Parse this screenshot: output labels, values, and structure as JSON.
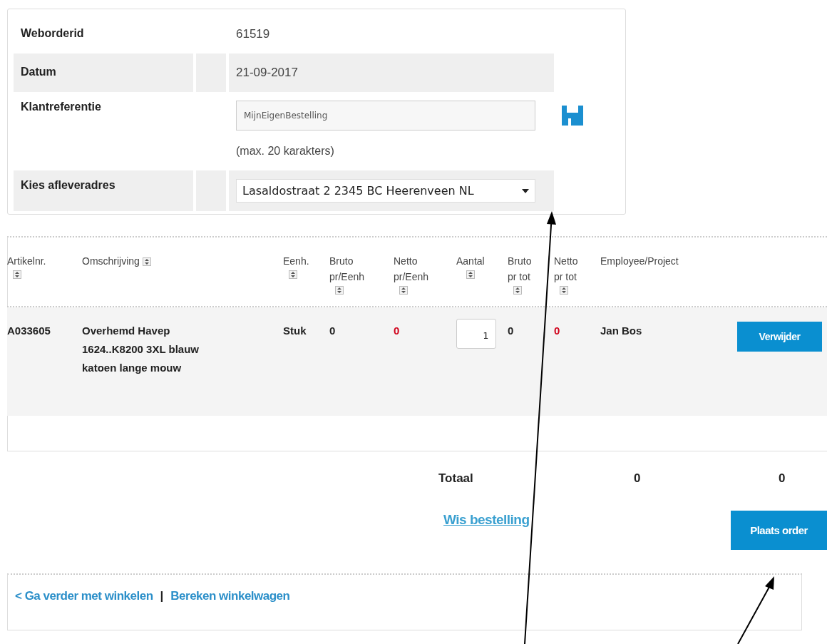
{
  "order_info": {
    "rows": [
      {
        "kind": "text",
        "label": "Weborderid",
        "value": "61519",
        "shaded": false
      },
      {
        "kind": "text",
        "label": "Datum",
        "value": "21-09-2017",
        "shaded": true
      },
      {
        "kind": "input",
        "label": "Klantreferentie",
        "value": "MijnEigenBestelling",
        "hint": "(max. 20 karakters)",
        "shaded": false
      },
      {
        "kind": "select",
        "label": "Kies afleveradres",
        "value": "Lasaldostraat 2 2345 BC Heerenveen NL",
        "shaded": true
      }
    ]
  },
  "table": {
    "columns": [
      {
        "label": "Artikelnr.",
        "sortable": true
      },
      {
        "label": "Omschrijving",
        "sortable": true
      },
      {
        "label": "Eenh.",
        "sortable": true
      },
      {
        "label": "Bruto\npr/Eenh",
        "sortable": true
      },
      {
        "label": "Netto\npr/Eenh",
        "sortable": true
      },
      {
        "label": "Aantal",
        "sortable": true
      },
      {
        "label": "Bruto\npr tot",
        "sortable": true
      },
      {
        "label": "Netto\npr tot",
        "sortable": true
      },
      {
        "label": "Employee/Project",
        "sortable": false
      }
    ],
    "rows": [
      {
        "cells": [
          {
            "kind": "code",
            "text": "A033605",
            "warning": false
          },
          {
            "kind": "bold",
            "text": "Overhemd Havep 1624..K8200 3XL blauw katoen lange mouw",
            "warning": false
          },
          {
            "kind": "bold",
            "text": "Stuk",
            "warning": false
          },
          {
            "kind": "bold",
            "text": "0",
            "warning": false
          },
          {
            "kind": "bold",
            "text": "0",
            "warning": true
          },
          {
            "kind": "quantity",
            "text": "1",
            "warning": false
          },
          {
            "kind": "bold",
            "text": "0",
            "warning": false
          },
          {
            "kind": "bold",
            "text": "0",
            "warning": true
          },
          {
            "kind": "bold",
            "text": "Jan Bos",
            "warning": false
          }
        ],
        "action": "Verwijder"
      }
    ]
  },
  "totals": {
    "label": "Totaal",
    "bruto": "0",
    "netto": "0"
  },
  "clear_link": "Wis bestelling",
  "place_order": "Plaats order",
  "footer": {
    "back_link": "< Ga verder met winkelen",
    "separator": "|",
    "calc_link": "Bereken winkelwagen"
  }
}
